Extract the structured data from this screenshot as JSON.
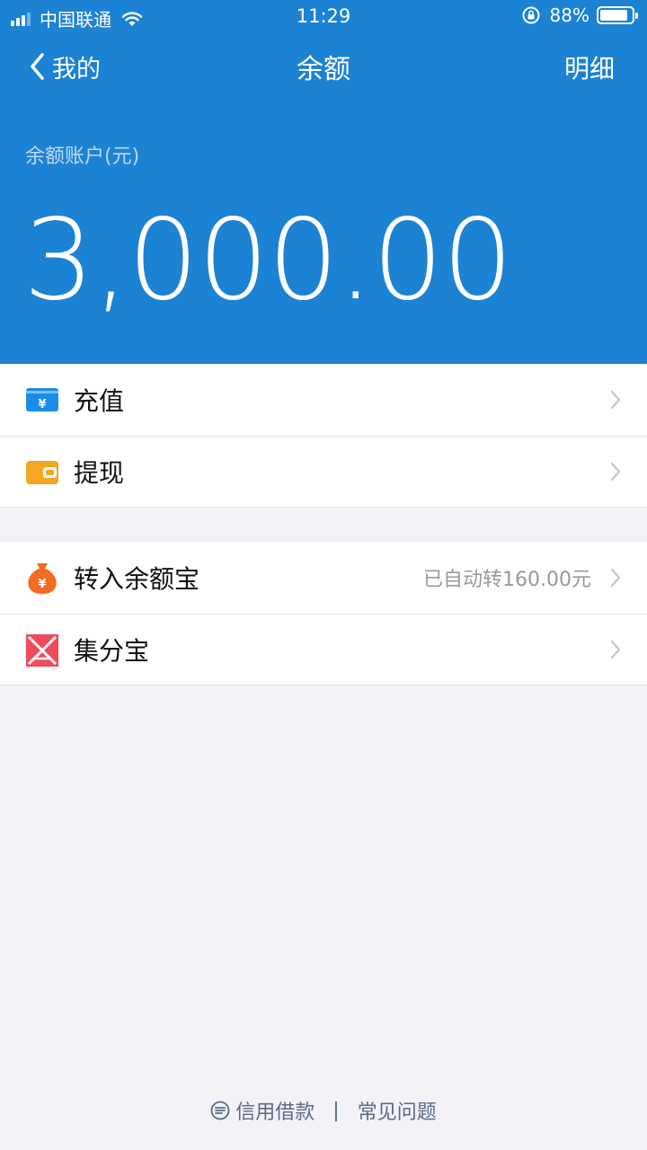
{
  "status_bar": {
    "carrier": "中国联通",
    "time": "11:29",
    "battery_percent": "88%",
    "battery_level": 0.88
  },
  "nav": {
    "back_label": "我的",
    "title": "余额",
    "right_label": "明细"
  },
  "account": {
    "label": "余额账户(元)",
    "balance": "3,000.00"
  },
  "group1": [
    {
      "label": "充值",
      "icon": "recharge-card-icon"
    },
    {
      "label": "提现",
      "icon": "wallet-icon"
    }
  ],
  "group2": [
    {
      "label": "转入余额宝",
      "value": "已自动转160.00元",
      "icon": "money-bag-icon"
    },
    {
      "label": "集分宝",
      "icon": "jifenbao-icon"
    }
  ],
  "footer": {
    "loan_label": "信用借款",
    "separator": "|",
    "faq_label": "常见问题"
  },
  "colors": {
    "header_blue": "#1c82d4",
    "recharge_blue": "#1a8ce6",
    "wallet_orange": "#f5a623",
    "bag_orange": "#f26c22",
    "jifen_red": "#f04b5a"
  }
}
